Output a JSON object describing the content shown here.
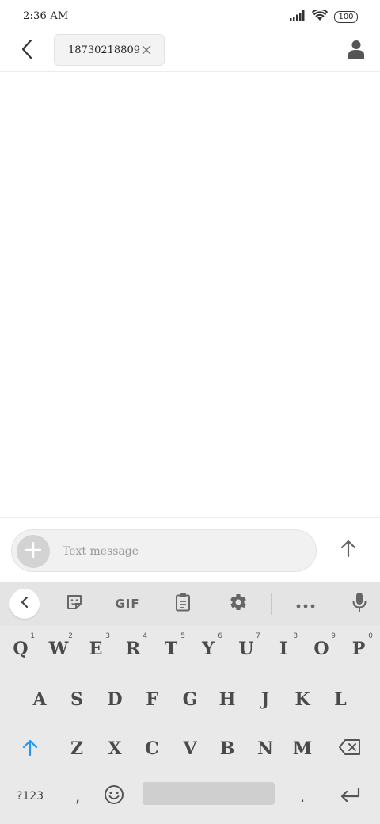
{
  "status_bar": {
    "time": "2:36 AM",
    "battery": "100",
    "icons": [
      "signal-icon",
      "wifi-icon",
      "battery-icon"
    ]
  },
  "header": {
    "recipient_chip": "18730218809",
    "icons": [
      "back-arrow-icon",
      "close-icon",
      "contact-person-icon"
    ]
  },
  "composer": {
    "placeholder": "Text message",
    "value": "",
    "icons": [
      "plus-icon",
      "send-arrow-icon"
    ]
  },
  "keyboard": {
    "toolbar": {
      "gif_label": "GIF",
      "icons": [
        "chevron-left-icon",
        "sticker-icon",
        "clipboard-icon",
        "gear-icon",
        "more-dots-icon",
        "microphone-icon"
      ]
    },
    "row1": [
      {
        "label": "Q",
        "hint": "1"
      },
      {
        "label": "W",
        "hint": "2"
      },
      {
        "label": "E",
        "hint": "3"
      },
      {
        "label": "R",
        "hint": "4"
      },
      {
        "label": "T",
        "hint": "5"
      },
      {
        "label": "Y",
        "hint": "6"
      },
      {
        "label": "U",
        "hint": "7"
      },
      {
        "label": "I",
        "hint": "8"
      },
      {
        "label": "O",
        "hint": "9"
      },
      {
        "label": "P",
        "hint": "0"
      }
    ],
    "row2": [
      "A",
      "S",
      "D",
      "F",
      "G",
      "H",
      "J",
      "K",
      "L"
    ],
    "row3": [
      "Z",
      "X",
      "C",
      "V",
      "B",
      "N",
      "M"
    ],
    "symbols_label": "?123",
    "comma": ",",
    "period": ".",
    "accent_color": "#2196f3"
  }
}
